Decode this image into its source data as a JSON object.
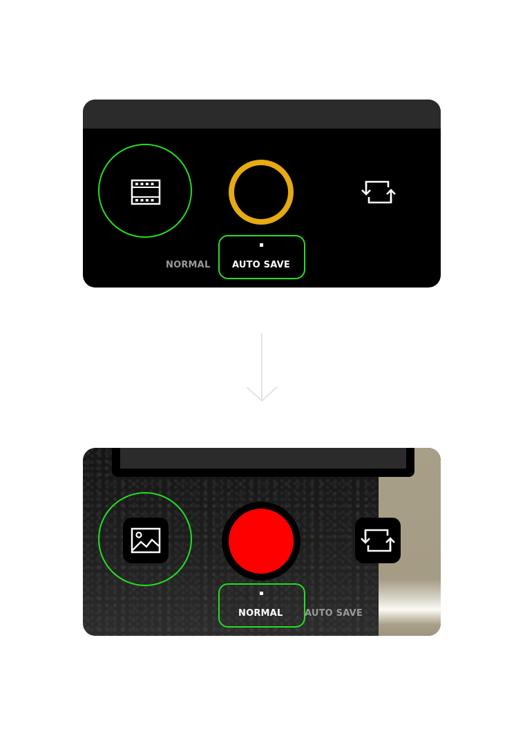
{
  "panel_before": {
    "modes": {
      "normal_label": "NORMAL",
      "autosave_label": "AUTO SAVE",
      "active": "AUTO SAVE"
    },
    "left_icon": "film-strip-icon",
    "right_icon": "switch-camera-icon",
    "shutter_style": "ring"
  },
  "panel_after": {
    "modes": {
      "normal_label": "NORMAL",
      "autosave_label": "AUTO SAVE",
      "active": "NORMAL"
    },
    "left_icon": "gallery-image-icon",
    "right_icon": "switch-camera-icon",
    "shutter_style": "filled"
  },
  "transition_icon": "arrow-down-icon",
  "colors": {
    "highlight_green": "#22e022",
    "shutter_ring_gold": "#e6aa12",
    "shutter_red": "#ff0000",
    "panel_black": "#000000",
    "topbar_gray": "#2b2b2b",
    "inactive_label_gray": "#9a9a9a",
    "active_label_white": "#ffffff",
    "arrow_gray": "#e4e4e4"
  }
}
